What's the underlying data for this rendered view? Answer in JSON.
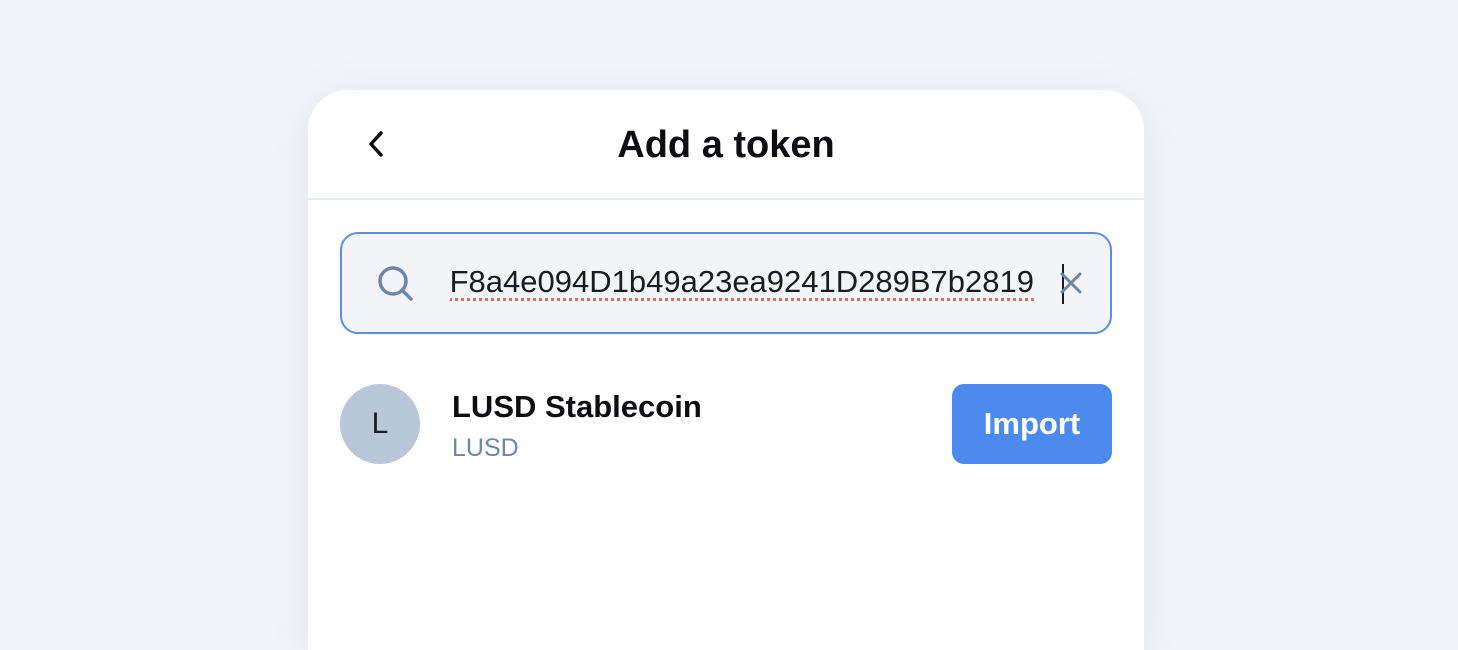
{
  "header": {
    "title": "Add a token",
    "back_icon": "chevron-left-icon"
  },
  "search": {
    "value": "F8a4e094D1b49a23ea9241D289B7b2819",
    "search_icon": "search-icon",
    "clear_icon": "close-icon"
  },
  "results": [
    {
      "avatar_letter": "L",
      "name": "LUSD Stablecoin",
      "symbol": "LUSD",
      "action_label": "Import"
    }
  ],
  "colors": {
    "accent": "#4c8aee",
    "search_border": "#5b8fe0",
    "avatar_bg": "#b9c7d9",
    "symbol_text": "#6e86a8",
    "background": "#f2f4f9"
  }
}
